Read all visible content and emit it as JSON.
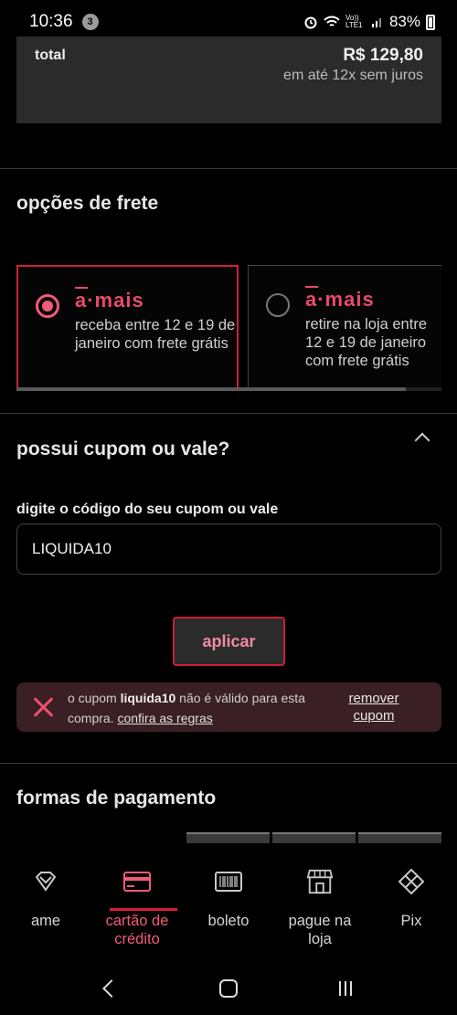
{
  "status_bar": {
    "time": "10:36",
    "notification_count": "3",
    "network": "Vo)) LTE1",
    "battery": "83%"
  },
  "summary": {
    "total_label": "total",
    "total_value": "R$ 129,80",
    "installments": "em até 12x sem juros"
  },
  "shipping": {
    "title": "opções de frete",
    "options": [
      {
        "brand": "a·mais",
        "text": "receba entre 12 e 19 de janeiro com frete grátis",
        "selected": true
      },
      {
        "brand": "a·mais",
        "text": "retire na loja entre 12 e 19 de janeiro com frete grátis",
        "selected": false
      }
    ]
  },
  "coupon": {
    "title": "possui cupom ou vale?",
    "field_label": "digite o código do seu cupom ou vale",
    "field_value": "LIQUIDA10",
    "apply_label": "aplicar",
    "error": {
      "prefix": "o cupom ",
      "code": "liquida10",
      "middle": " não é válido para esta compra. ",
      "link": "confira as regras",
      "remove_label": "remover cupom"
    }
  },
  "payment": {
    "title": "formas de pagamento",
    "tabs": [
      {
        "label": "ame",
        "icon": "ame-diamond-icon",
        "active": false
      },
      {
        "label": "cartão de crédito",
        "icon": "credit-card-icon",
        "active": true
      },
      {
        "label": "boleto",
        "icon": "barcode-icon",
        "active": false
      },
      {
        "label": "pague na loja",
        "icon": "store-icon",
        "active": false
      },
      {
        "label": "Pix",
        "icon": "pix-icon",
        "active": false
      }
    ]
  },
  "colors": {
    "accent": "#d21e3a",
    "accent_light": "#f05b78",
    "background": "#000000",
    "card": "#2b2b2b",
    "error_bg": "#3a1f24"
  }
}
